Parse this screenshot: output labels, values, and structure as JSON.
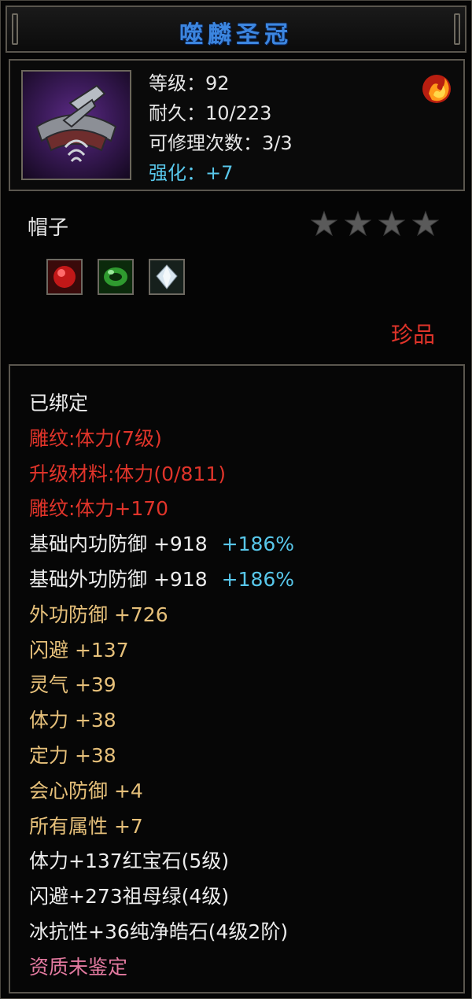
{
  "item": {
    "name": "噬麟圣冠",
    "icon": "crown-headpiece-icon",
    "stats": {
      "level": "等级：92",
      "durability": "耐久：10/223",
      "repairs": "可修理次数：3/3",
      "enhance": "强化：+7"
    },
    "type": "帽子",
    "stars": 4,
    "gems": [
      "ruby-gem-icon",
      "emerald-gem-icon",
      "diamond-gem-icon"
    ],
    "rarity": "珍品"
  },
  "properties": [
    {
      "text": "已绑定",
      "color": "#ececec"
    },
    {
      "text": "雕纹:体力(7级)",
      "color": "#e0342a"
    },
    {
      "text": "升级材料:体力(0/811)",
      "color": "#e0342a"
    },
    {
      "text": "雕纹:体力+170",
      "color": "#e0342a"
    },
    {
      "text": "基础内功防御  +918",
      "extra": "+186%",
      "color": "#ececec"
    },
    {
      "text": "基础外功防御  +918",
      "extra": "+186%",
      "color": "#ececec"
    },
    {
      "text": "外功防御  +726",
      "color": "#e6c07a"
    },
    {
      "text": "闪避  +137",
      "color": "#e6c07a"
    },
    {
      "text": "灵气  +39",
      "color": "#e6c07a"
    },
    {
      "text": "体力  +38",
      "color": "#e6c07a"
    },
    {
      "text": "定力  +38",
      "color": "#e6c07a"
    },
    {
      "text": "会心防御  +4",
      "color": "#e6c07a"
    },
    {
      "text": "所有属性  +7",
      "color": "#e6c07a"
    },
    {
      "text": "体力+137红宝石(5级)",
      "color": "#ececec"
    },
    {
      "text": "闪避+273祖母绿(4级)",
      "color": "#ececec"
    },
    {
      "text": "冰抗性+36纯净皓石(4级2阶)",
      "color": "#ececec"
    },
    {
      "text": "资质未鉴定",
      "color": "#e47aa0"
    }
  ],
  "colors": {
    "title": "#3c86e0",
    "enhance": "#58c7ea",
    "rarity": "#e0342a"
  }
}
